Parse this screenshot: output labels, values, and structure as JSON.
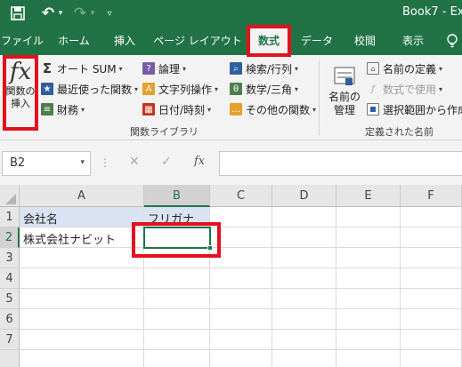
{
  "titlebar": {
    "save_icon": "save-icon",
    "undo_glyph": "↶",
    "redo_glyph": "↷",
    "dropdown_glyph": "▾",
    "customize_glyph": "▿",
    "book_title": "Book7 - Ex"
  },
  "tabs": [
    {
      "label": "ファイル"
    },
    {
      "label": "ホーム"
    },
    {
      "label": "挿入"
    },
    {
      "label": "ページ レイアウト"
    },
    {
      "label": "数式",
      "active": true
    },
    {
      "label": "データ"
    },
    {
      "label": "校閲"
    },
    {
      "label": "表示"
    }
  ],
  "tell_me_icon": "lightbulb-icon",
  "ribbon": {
    "insert_function": {
      "glyph": "fx",
      "line1": "関数の",
      "line2": "挿入"
    },
    "library": {
      "autosum": "オート SUM",
      "recent": "最近使った関数",
      "financial": "財務",
      "logical": "論理",
      "text": "文字列操作",
      "datetime": "日付/時刻",
      "lookup": "検索/行列",
      "math": "数学/三角",
      "more": "その他の関数",
      "group_label": "関数ライブラリ"
    },
    "names": {
      "manager_line1": "名前の",
      "manager_line2": "管理",
      "define": "名前の定義",
      "use_in_formula": "数式で使用",
      "create_from_selection": "選択範囲から作成",
      "group_label": "定義された名前"
    }
  },
  "formula_bar": {
    "name_box": "B2",
    "cancel_glyph": "✕",
    "enter_glyph": "✓",
    "fx_glyph": "fx",
    "value": ""
  },
  "grid": {
    "columns": [
      "A",
      "B",
      "C",
      "D",
      "E",
      "F"
    ],
    "rows": [
      "1",
      "2",
      "3",
      "4",
      "5",
      "6",
      "7"
    ],
    "cells": {
      "A1": "会社名",
      "B1": "フリガナ",
      "A2": "株式会社ナビット",
      "B2": ""
    },
    "active_cell": "B2"
  },
  "colors": {
    "brand": "#217346",
    "highlight": "#e5101d",
    "header_fill": "#dae3f3"
  }
}
